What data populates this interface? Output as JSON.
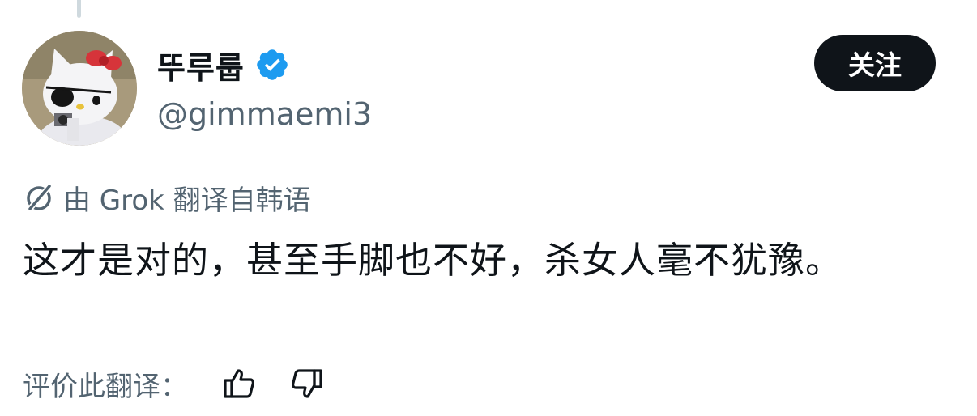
{
  "author": {
    "display_name": "뚜루룹",
    "handle": "@gimmaemi3",
    "verified": true,
    "avatar_icon": "hello-kitty-avatar"
  },
  "follow_button": {
    "label": "关注"
  },
  "translation": {
    "label": "由 Grok 翻译自韩语",
    "icon": "grok-icon"
  },
  "tweet": {
    "text": "这才是对的，甚至手脚也不好，杀女人毫不犹豫。"
  },
  "rating": {
    "label": "评价此翻译：",
    "thumbs_up_icon": "thumbs-up-icon",
    "thumbs_down_icon": "thumbs-down-icon"
  },
  "colors": {
    "text_primary": "#0f1419",
    "text_secondary": "#536471",
    "verified_blue": "#1d9bf0",
    "follow_bg": "#0f1419"
  }
}
